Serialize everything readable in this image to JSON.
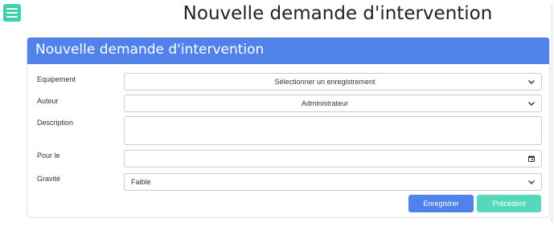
{
  "page": {
    "title": "Nouvelle demande d'intervention"
  },
  "icons": {
    "menu": "hamburger-icon",
    "chevron": "chevron-down-icon",
    "calendar": "calendar-icon"
  },
  "colors": {
    "accent": "#5082ea",
    "teal": "#55d8bc",
    "menu": "#3fd0b0"
  },
  "panel": {
    "header": "Nouvelle demande d'intervention"
  },
  "form": {
    "equipement": {
      "label": "Equipement",
      "value": "Sélectionner un enregistrement"
    },
    "auteur": {
      "label": "Auteur",
      "value": "Administrateur"
    },
    "description": {
      "label": "Description",
      "value": ""
    },
    "pour_le": {
      "label": "Pour le",
      "value": ""
    },
    "gravite": {
      "label": "Gravité",
      "value": "Faible"
    }
  },
  "buttons": {
    "save": "Enregistrer",
    "back": "Précédent"
  }
}
